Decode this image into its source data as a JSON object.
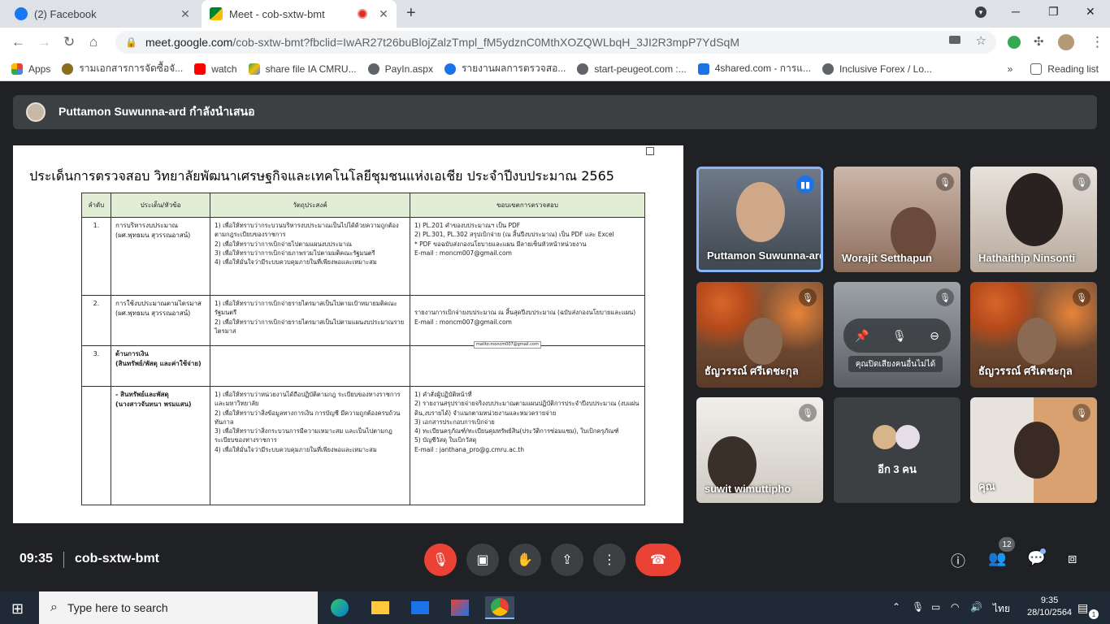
{
  "tabs": [
    {
      "title": "(2) Facebook",
      "close": "✕"
    },
    {
      "title": "Meet - cob-sxtw-bmt",
      "close": "✕"
    }
  ],
  "new_tab": "+",
  "window_controls": {
    "dropdown": "▾",
    "minimize": "─",
    "restore": "❐",
    "close": "✕"
  },
  "address": {
    "host": "meet.google.com",
    "path": "/cob-sxtw-bmt?fbclid=IwAR27t26buBlojZalzTmpl_fM5ydznC0MthXOZQWLbqH_3JI2R3mpP7YdSqM"
  },
  "bookmarks": [
    {
      "label": "Apps",
      "color": "#4285f4"
    },
    {
      "label": "รามเอกสารการจัดซื้อจั...",
      "color": "#8a6d1d"
    },
    {
      "label": "watch",
      "color": "#ff0000"
    },
    {
      "label": "share file IA CMRU...",
      "color": "#fbbc04"
    },
    {
      "label": "PayIn.aspx",
      "color": "#5f6368"
    },
    {
      "label": "รายงานผลการตรวจสอ...",
      "color": "#1a73e8"
    },
    {
      "label": "start-peugeot.com :...",
      "color": "#5f6368"
    },
    {
      "label": "4shared.com - การแ...",
      "color": "#1a73e8"
    },
    {
      "label": "Inclusive Forex / Lo...",
      "color": "#5f6368"
    }
  ],
  "bookmarks_more": "»",
  "reading_list": "Reading list",
  "presenter_text": "Puttamon Suwunna-ard กำลังนำเสนอ",
  "slide": {
    "title": "ประเด็นการตรวจสอบ วิทยาลัยพัฒนาเศรษฐกิจและเทคโนโลยีชุมชนแห่งเอเชีย  ประจำปีงบประมาณ 2565",
    "headers": [
      "ลำดับ",
      "ประเด็น/หัวข้อ",
      "วัตถุประสงค์",
      "ขอบเขตการตรวจสอบ"
    ],
    "rows": [
      {
        "no": "1.",
        "topic": "การบริหารงบประมาณ\n(ผศ.พุทธมน สุวรรณอาสน์)",
        "objective": "1) เพื่อให้ทราบว่ากระบวนบริหารงบประมาณเป็นไปได้ด้วยความถูกต้องตามกฎระเบียบของราชการ\n2) เพื่อให้ทราบว่าการเบิกจ่ายไปตามแผนงบประมาณ\n3) เพื่อให้ทราบว่าการเบิกจ่ายภาพรวมไปตามมติคณะรัฐมนตรี\n4) เพื่อให้มั่นใจว่ามีระบบควบคุมภายในที่เพียงพอและเหมาะสม",
        "scope": "1) PL.201 คำของบประมาณฯ เป็น PDF\n2) PL.301, PL.302 สรุปเบิกจ่าย (ณ สิ้นปีงบประมาณ) เป็น PDF และ Excel\n* PDF ขอฉบับส่งกองนโยบายและแผน มีลายเซ็นหัวหน้าหน่วยงาน\nE-mail : moncm007@gmail.com"
      },
      {
        "no": "2.",
        "topic": "การใช้งบประมาณตามไตรมาส\n(ผศ.พุทธมน สุวรรณอาสน์)",
        "objective": "1) เพื่อให้ทราบว่าการเบิกจ่ายรายไตรมาสเป็นไปตามเป้าหมายมติคณะรัฐมนตรี\n2) เพื่อให้ทราบว่าการเบิกจ่ายรายไตรมาสเป็นไปตามแผนงบประมาณรายไตรมาส",
        "scope": "รายงานการเบิกจ่ายงบประมาณ ณ สิ้นสุดปีงบประมาณ (ฉบับส่งกองนโยบายและแผน)\nE-mail : moncm007@gmail.com"
      },
      {
        "no": "3.",
        "topic": "ด้านการเงิน\n(สินทรัพย์/พัสดุ และค่าใช้จ่าย)",
        "objective": "",
        "scope": ""
      },
      {
        "no": "",
        "topic": "- สินทรัพย์และพัสดุ\n(นางสาวจันทนา พรมแสน)",
        "objective": "1) เพื่อให้ทราบว่าหน่วยงานได้ถือปฏิบัติตามกฎ ระเบียบของทางราชการ และมหาวิทยาลัย\n2) เพื่อให้ทราบว่าสิ่งข้อมูลทางการเงิน การบัญชี มีความถูกต้องครบถ้วน ทันกาล\n3) เพื่อให้ทราบว่าสิ่งกระบวนการมีความเหมาะสม และเป็นไปตามกฎ ระเบียบของทางราชการ\n4) เพื่อให้มั่นใจว่ามีระบบควบคุมภายในที่เพียงพอและเหมาะสม",
        "scope": "1) คำสั่งผู้ปฏิบัติหน้าที่\n2) รายงานสรุปรายจ่ายจริงงบประมาณตามแผนปฏิบัติการประจำปีงบประมาณ (งบแผ่นดิน,งบรายได้) จำแนกตามหน่วยงานและหมวดรายจ่าย\n3) เอกสารประกอบการเบิกจ่าย\n4) ทะเบียนครุภัณฑ์/ทะเบียนคุมทรัพย์สิน(ประวัติการซ่อมแซม), ใบเบิกครุภัณฑ์\n5) บัญชีวัสดุ ใบเบิกวัสดุ\nE-mail : janthana_pro@g.cmru.ac.th"
      }
    ],
    "hover_tip": "mailto:moncm007@gmail.com"
  },
  "participants": [
    {
      "name": "Puttamon Suwunna-ard",
      "speaking": true
    },
    {
      "name": "Worajit Setthapun",
      "muted": true
    },
    {
      "name": "Hathaithip Ninsonti",
      "muted": true
    },
    {
      "name": "ธัญวรรณ์ ศรีเดชะกุล",
      "muted": true
    },
    {
      "name": "",
      "muted": true
    },
    {
      "name": "ธัญวรรณ์ ศรีเดชะกุล",
      "muted": true
    },
    {
      "name": "suwit wimuttipho",
      "muted": true
    },
    {
      "name": "อีก 3 คน"
    },
    {
      "name": "คุณ",
      "muted": true
    }
  ],
  "overlay_tip": "คุณปิดเสียงคนอื่นไม่ได้",
  "meeting": {
    "time": "09:35",
    "code": "cob-sxtw-bmt"
  },
  "people_count": "12",
  "taskbar": {
    "search": "Type here to search",
    "lang": "ไทย",
    "time": "9:35",
    "date": "28/10/2564",
    "notif": "1"
  }
}
